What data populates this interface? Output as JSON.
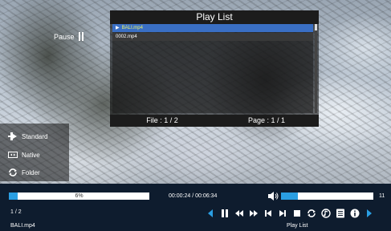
{
  "video": {
    "paused_label": "Pause"
  },
  "playlist": {
    "title": "Play List",
    "items": [
      {
        "name": "BALI.mp4",
        "selected": true
      },
      {
        "name": "0002.mp4",
        "selected": false
      }
    ],
    "file_counter": "File : 1 / 2",
    "page_counter": "Page : 1 / 1"
  },
  "side_menu": {
    "items": [
      {
        "label": "Standard",
        "icon": "aspect-standard-icon"
      },
      {
        "label": "Native",
        "icon": "aspect-native-icon"
      },
      {
        "label": "Folder",
        "icon": "folder-repeat-icon"
      }
    ]
  },
  "controls": {
    "progress_percent": 6,
    "progress_label": "6%",
    "time": "00:00:24 / 00:06:34",
    "volume_level": 11,
    "volume_fraction": 0.18,
    "volume_label": "11",
    "file_index": "1 / 2",
    "file_name": "BALI.mp4",
    "hover_label": "Play List",
    "buttons": [
      "prev-page-icon",
      "pause-icon",
      "rewind-icon",
      "fast-forward-icon",
      "skip-previous-icon",
      "skip-next-icon",
      "stop-icon",
      "repeat-icon",
      "audio-track-icon",
      "playlist-icon",
      "info-icon",
      "next-page-icon"
    ]
  },
  "colors": {
    "accent": "#2a9ee2",
    "bar_bg": "#0e1c2e",
    "selected_row": "#3a6fc4",
    "selected_text": "#e8f06a"
  }
}
